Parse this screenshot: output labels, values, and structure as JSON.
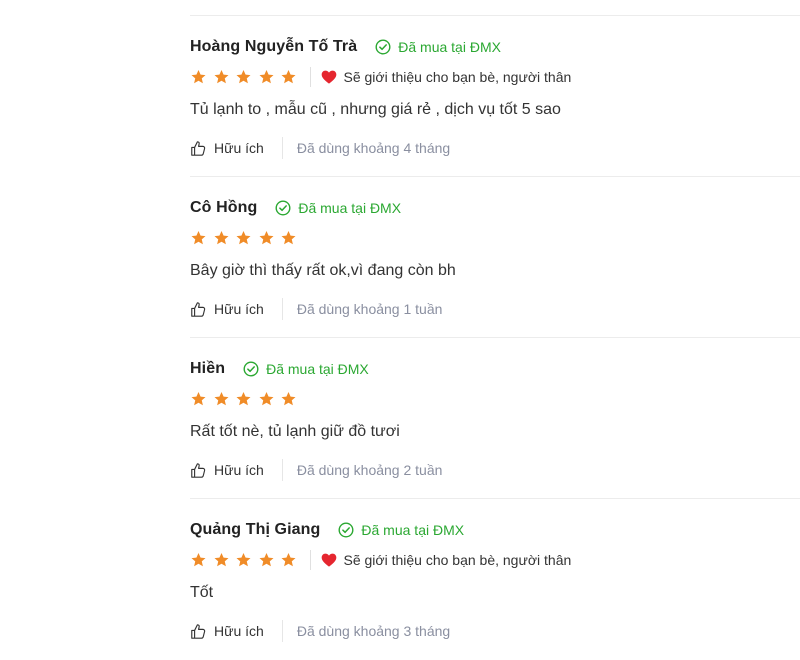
{
  "colors": {
    "star": "#f08c28",
    "verified": "#2ba832",
    "heart": "#e5262f",
    "used_text": "#8a8fa0"
  },
  "reviews": [
    {
      "name": "Hoàng Nguyễn Tố Trà",
      "verified": "Đã mua tại ĐMX",
      "stars": 5,
      "recommend": "Sẽ giới thiệu cho bạn bè, người thân",
      "content": "Tủ lạnh to , mẫu cũ , nhưng giá rẻ , dịch vụ tốt 5 sao",
      "helpful": "Hữu ích",
      "used": "Đã dùng khoảng 4 tháng"
    },
    {
      "name": "Cô Hồng",
      "verified": "Đã mua tại ĐMX",
      "stars": 5,
      "recommend": "",
      "content": "Bây giờ thì thấy rất ok,vì đang còn bh",
      "helpful": "Hữu ích",
      "used": "Đã dùng khoảng 1 tuần"
    },
    {
      "name": "Hiền",
      "verified": "Đã mua tại ĐMX",
      "stars": 5,
      "recommend": "",
      "content": "Rất tốt nè, tủ lạnh giữ đồ tươi",
      "helpful": "Hữu ích",
      "used": "Đã dùng khoảng 2 tuần"
    },
    {
      "name": "Quảng Thị Giang",
      "verified": "Đã mua tại ĐMX",
      "stars": 5,
      "recommend": "Sẽ giới thiệu cho bạn bè, người thân",
      "content": "Tốt",
      "helpful": "Hữu ích",
      "used": "Đã dùng khoảng 3 tháng"
    }
  ]
}
